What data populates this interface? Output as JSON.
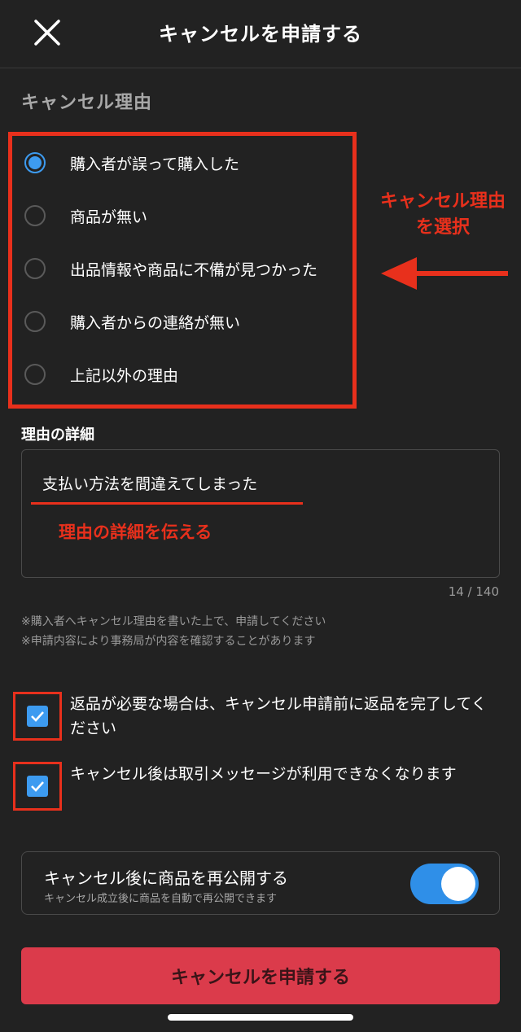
{
  "header": {
    "title": "キャンセルを申請する",
    "close_icon": "close-icon"
  },
  "reasons": {
    "section_label": "キャンセル理由",
    "options": [
      {
        "label": "購入者が誤って購入した",
        "selected": true
      },
      {
        "label": "商品が無い",
        "selected": false
      },
      {
        "label": "出品情報や商品に不備が見つかった",
        "selected": false
      },
      {
        "label": "購入者からの連絡が無い",
        "selected": false
      },
      {
        "label": "上記以外の理由",
        "selected": false
      }
    ]
  },
  "annotations": {
    "reason_line1": "キャンセル理由",
    "reason_line2": "を選択",
    "detail": "理由の詳細を伝える",
    "color": "#e8301c"
  },
  "detail": {
    "label": "理由の詳細",
    "value": "支払い方法を間違えてしまった",
    "char_count": "14 / 140"
  },
  "notes": [
    "※購入者へキャンセル理由を書いた上で、申請してください",
    "※申請内容により事務局が内容を確認することがあります"
  ],
  "confirmations": [
    {
      "label": "返品が必要な場合は、キャンセル申請前に返品を完了してください",
      "checked": true
    },
    {
      "label": "キャンセル後は取引メッセージが利用できなくなります",
      "checked": true
    }
  ],
  "republish": {
    "title": "キャンセル後に商品を再公開する",
    "subtitle": "キャンセル成立後に商品を自動で再公開できます",
    "enabled": true
  },
  "submit": {
    "label": "キャンセルを申請する"
  },
  "colors": {
    "accent": "#3d9bf0",
    "danger_button": "#db3b4b",
    "background": "#222222"
  }
}
